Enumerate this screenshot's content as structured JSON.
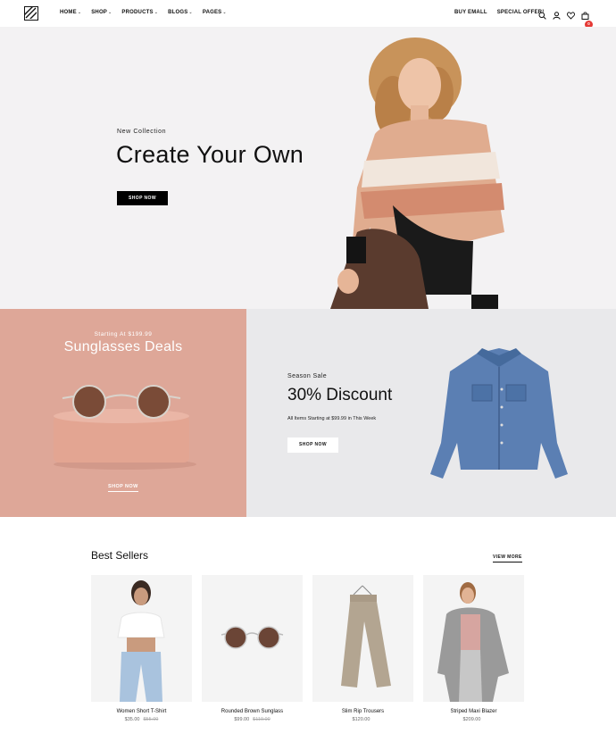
{
  "header": {
    "nav": [
      {
        "label": "HOME"
      },
      {
        "label": "SHOP"
      },
      {
        "label": "PRODUCTS"
      },
      {
        "label": "BLOGS"
      },
      {
        "label": "PAGES"
      }
    ],
    "right_links": [
      "BUY EMALL",
      "SPECIAL OFFER!"
    ],
    "icons": [
      "search-icon",
      "user-icon",
      "heart-icon",
      "cart-icon"
    ],
    "cart_count": "0"
  },
  "hero": {
    "kicker": "New Collection",
    "title": "Create Your Own",
    "button": "SHOP NOW"
  },
  "promo_left": {
    "kicker": "Starting At $199.99",
    "title": "Sunglasses Deals",
    "link": "SHOP NOW",
    "bg_color": "#dea798"
  },
  "promo_right": {
    "kicker": "Season Sale",
    "title": "30% Discount",
    "desc": "All Items Starting at $99.99 in This Week",
    "button": "SHOP NOW",
    "bg_color": "#e9e9eb"
  },
  "best_sellers": {
    "title": "Best Sellers",
    "view_more": "VIEW MORE",
    "products": [
      {
        "name": "Women Short T-Shirt",
        "price": "$35.00",
        "old_price": "$55.00"
      },
      {
        "name": "Rounded Brown Sunglass",
        "price": "$99.00",
        "old_price": "$119.00"
      },
      {
        "name": "Slim Rip Trousers",
        "price": "$120.00",
        "old_price": ""
      },
      {
        "name": "Striped Maxi Blazer",
        "price": "$209.00",
        "old_price": ""
      }
    ]
  }
}
